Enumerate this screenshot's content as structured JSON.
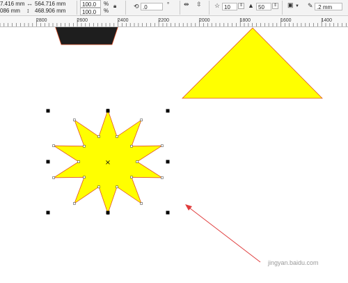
{
  "property_bar": {
    "x_position": "7.416 mm",
    "y_position": "086 mm",
    "width": "564.716 mm",
    "height": "468.906 mm",
    "scale_x": "100.0",
    "scale_y": "100.0",
    "percent_symbol": "%",
    "rotation": ".0",
    "degree_symbol": "°",
    "points_count": "10",
    "sharpness": "50",
    "outline_width": ".2 mm"
  },
  "ruler": {
    "labels": [
      "2800",
      "2600",
      "2400",
      "2200",
      "2000",
      "1800",
      "1600",
      "1400"
    ]
  },
  "canvas": {
    "shapes": [
      "dark-trapezoid",
      "yellow-triangle",
      "yellow-star-selected"
    ],
    "fill_color": "#ffff00",
    "outline_color": "#e0522a",
    "trapezoid_color": "#1e1e1e",
    "arrow_color": "#e03c3c"
  },
  "watermark": "jingyan.baidu.com"
}
